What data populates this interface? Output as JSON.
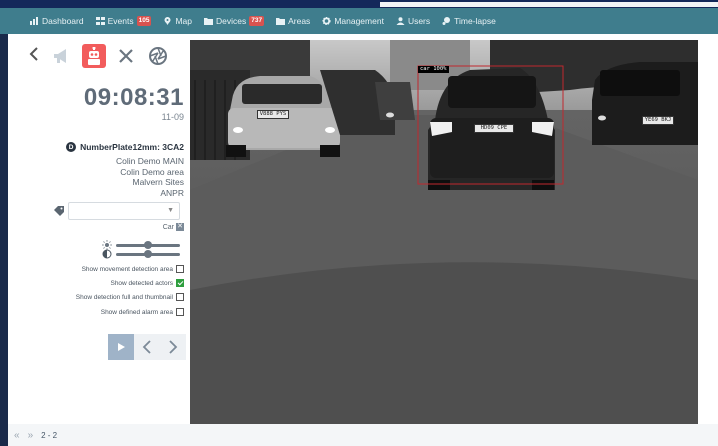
{
  "header": {
    "title_fragment": "...g...y..."
  },
  "nav": {
    "items": [
      {
        "label": "Dashboard",
        "icon": "bar-chart-icon"
      },
      {
        "label": "Events",
        "icon": "grid-icon",
        "badge": "105"
      },
      {
        "label": "Map",
        "icon": "map-pin-icon"
      },
      {
        "label": "Devices",
        "icon": "folder-icon",
        "badge": "737"
      },
      {
        "label": "Areas",
        "icon": "folder-icon"
      },
      {
        "label": "Management",
        "icon": "gear-icon"
      },
      {
        "label": "Users",
        "icon": "user-icon"
      },
      {
        "label": "Time-lapse",
        "icon": "time-lapse-icon"
      }
    ],
    "accent": "#3f7d8d",
    "badge_color": "#d9534f"
  },
  "panel": {
    "time": "09:08:31",
    "date": "11-09",
    "device_badge": "D",
    "device_name": "NumberPlate12mm: 3CA2",
    "info": [
      "Colin Demo MAIN",
      "Colin Demo area",
      "Malvern Sites",
      "ANPR"
    ],
    "tag_filter": "Car",
    "brightness_level": 0.5,
    "contrast_level": 0.5,
    "options": [
      {
        "label": "Show movement detection area",
        "checked": false
      },
      {
        "label": "Show detected actors",
        "checked": true
      },
      {
        "label": "Show detection full and thumbnail",
        "checked": false
      },
      {
        "label": "Show defined alarm area",
        "checked": false
      }
    ]
  },
  "camera": {
    "detection_label": "car 100%",
    "plates": [
      "V888 PYS",
      "HD09 CPE",
      "YE69 BKJ"
    ]
  },
  "footer": {
    "prev": "«",
    "next": "»",
    "count": "2 - 2"
  }
}
